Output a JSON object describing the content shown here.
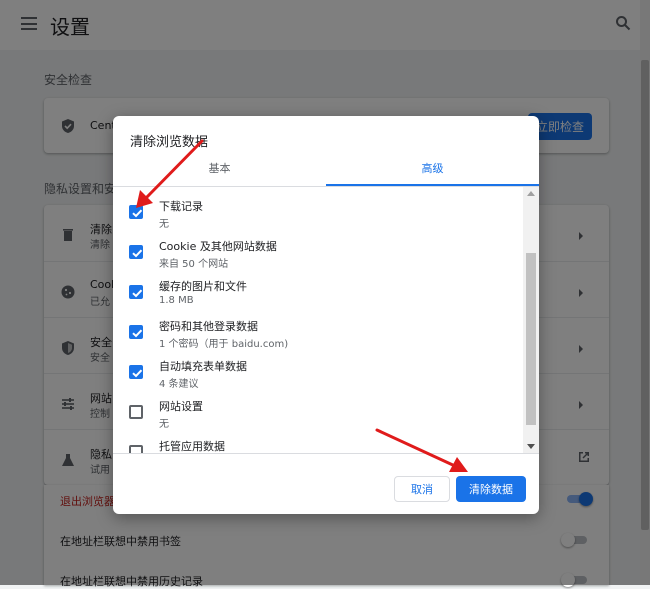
{
  "header": {
    "title": "设置"
  },
  "safety_check": {
    "heading": "安全检查",
    "row_text": "Cent",
    "button_label": "立即检查"
  },
  "privacy": {
    "heading": "隐私设置和安",
    "rows": [
      {
        "t1": "清除",
        "t2": "清除"
      },
      {
        "t1": "Cook",
        "t2": "已允"
      },
      {
        "t1": "安全",
        "t2": "安全"
      },
      {
        "t1": "网站",
        "t2": "控制"
      },
      {
        "t1": "隐私",
        "t2": "试用"
      }
    ],
    "exit_text": "退出浏览器",
    "suggest_bookmarks": "在地址栏联想中禁用书签",
    "suggest_history": "在地址栏联想中禁用历史记录"
  },
  "dialog": {
    "title": "清除浏览数据",
    "tabs": [
      {
        "label": "基本",
        "active": false
      },
      {
        "label": "高级",
        "active": true
      }
    ],
    "items": [
      {
        "label": "下载记录",
        "sub": "无",
        "checked": true
      },
      {
        "label": "Cookie 及其他网站数据",
        "sub": "来自 50 个网站",
        "checked": true
      },
      {
        "label": "缓存的图片和文件",
        "sub": "1.8 MB",
        "checked": true
      },
      {
        "label": "密码和其他登录数据",
        "sub": "1 个密码（用于 baidu.com)",
        "checked": true
      },
      {
        "label": "自动填充表单数据",
        "sub": "4 条建议",
        "checked": true
      },
      {
        "label": "网站设置",
        "sub": "无",
        "checked": false
      },
      {
        "label": "托管应用数据",
        "sub": "",
        "checked": false
      }
    ],
    "cancel_label": "取消",
    "clear_label": "清除数据"
  },
  "colors": {
    "accent": "#1a73e8",
    "warning_text": "#c5221f",
    "annotation_arrow": "#e01b1b"
  }
}
